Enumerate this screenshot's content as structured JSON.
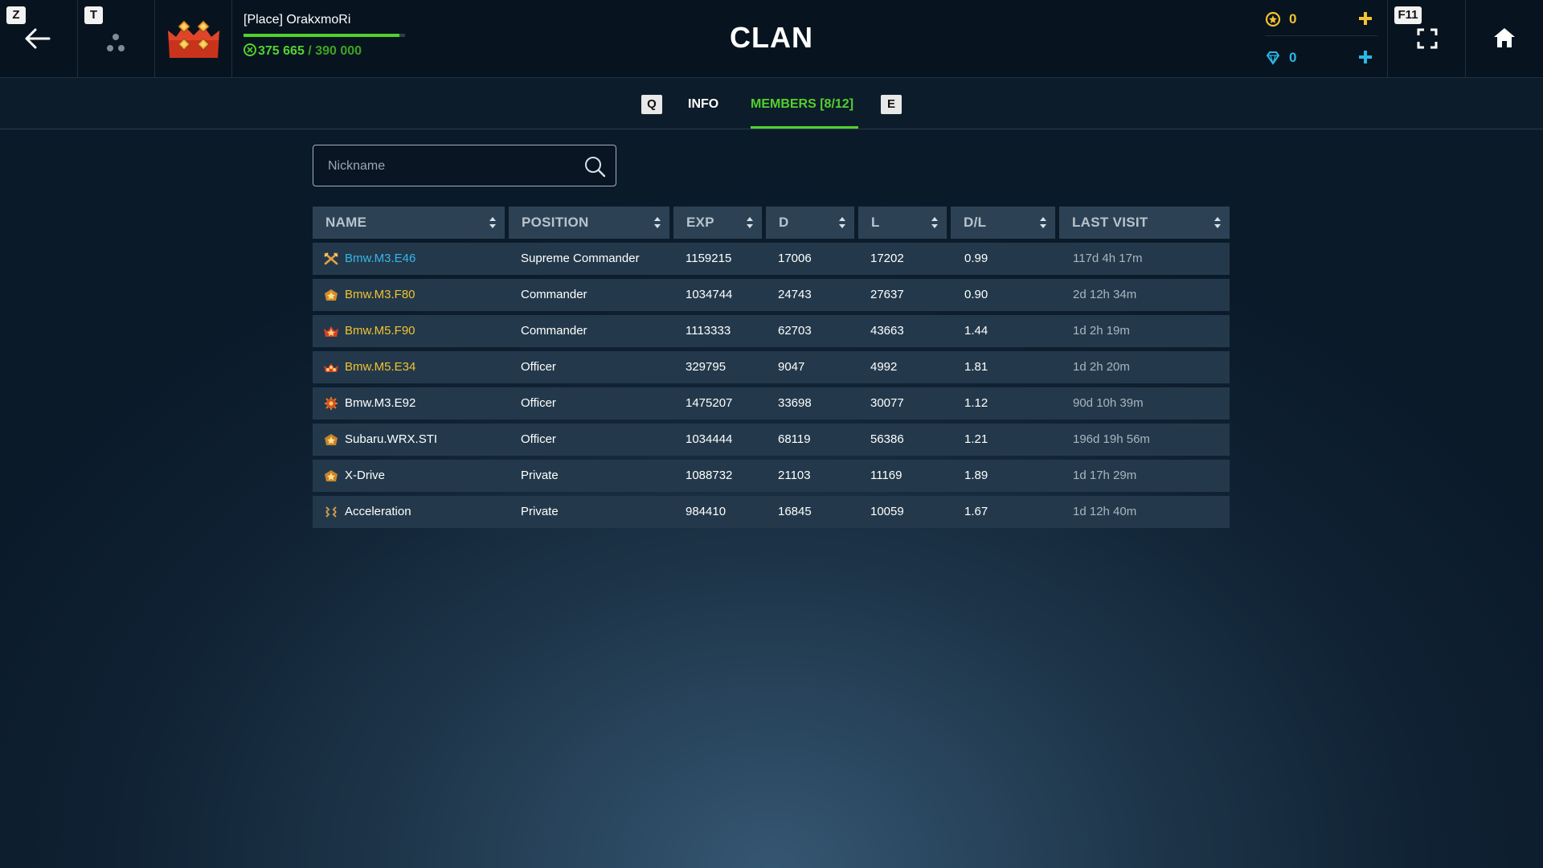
{
  "header": {
    "back_key": "Z",
    "squad_key": "T",
    "player_name": "[Place] OrakxmoRi",
    "xp_current": "375 665",
    "xp_separator": " / ",
    "xp_max": "390 000",
    "xp_progress_fraction": 0.963,
    "title": "CLAN",
    "gold_value": "0",
    "gem_value": "0",
    "fullscreen_key": "F11"
  },
  "tabs": {
    "prev_key": "Q",
    "next_key": "E",
    "info_label": "INFO",
    "members_label": "MEMBERS [8/12]",
    "active": "members"
  },
  "search": {
    "placeholder": "Nickname",
    "value": ""
  },
  "table": {
    "columns": [
      "NAME",
      "POSITION",
      "EXP",
      "D",
      "L",
      "D/L",
      "LAST VISIT"
    ],
    "rows": [
      {
        "name": "Bmw.M3.E46",
        "position": "Supreme Commander",
        "exp": "1159215",
        "d": "17006",
        "l": "17202",
        "dl": "0.99",
        "last_visit": "117d 4h 17m",
        "name_color": "#36b6e8",
        "rank_icon": "crossed-swords-icon"
      },
      {
        "name": "Bmw.M3.F80",
        "position": "Commander",
        "exp": "1034744",
        "d": "24743",
        "l": "27637",
        "dl": "0.90",
        "last_visit": "2d 12h 34m",
        "name_color": "#f2c230",
        "rank_icon": "commander-star-icon"
      },
      {
        "name": "Bmw.M5.F90",
        "position": "Commander",
        "exp": "1113333",
        "d": "62703",
        "l": "43663",
        "dl": "1.44",
        "last_visit": "1d 2h 19m",
        "name_color": "#f2c230",
        "rank_icon": "commander-wings-icon"
      },
      {
        "name": "Bmw.M5.E34",
        "position": "Officer",
        "exp": "329795",
        "d": "9047",
        "l": "4992",
        "dl": "1.81",
        "last_visit": "1d 2h 20m",
        "name_color": "#f2c230",
        "rank_icon": "officer-crown-icon"
      },
      {
        "name": "Bmw.M3.E92",
        "position": "Officer",
        "exp": "1475207",
        "d": "33698",
        "l": "30077",
        "dl": "1.12",
        "last_visit": "90d 10h 39m",
        "name_color": "#ffffff",
        "rank_icon": "officer-gear-icon"
      },
      {
        "name": "Subaru.WRX.STI",
        "position": "Officer",
        "exp": "1034444",
        "d": "68119",
        "l": "56386",
        "dl": "1.21",
        "last_visit": "196d 19h 56m",
        "name_color": "#ffffff",
        "rank_icon": "officer-star-icon"
      },
      {
        "name": "X-Drive",
        "position": "Private",
        "exp": "1088732",
        "d": "21103",
        "l": "11169",
        "dl": "1.89",
        "last_visit": "1d 17h 29m",
        "name_color": "#ffffff",
        "rank_icon": "private-star-icon"
      },
      {
        "name": "Acceleration",
        "position": "Private",
        "exp": "984410",
        "d": "16845",
        "l": "10059",
        "dl": "1.67",
        "last_visit": "1d 12h 40m",
        "name_color": "#ffffff",
        "rank_icon": "private-chevrons-icon"
      }
    ]
  },
  "colors": {
    "accent_green": "#52d12e",
    "gold": "#f2c230",
    "gem": "#2bb6e6",
    "name_leader": "#36b6e8"
  }
}
